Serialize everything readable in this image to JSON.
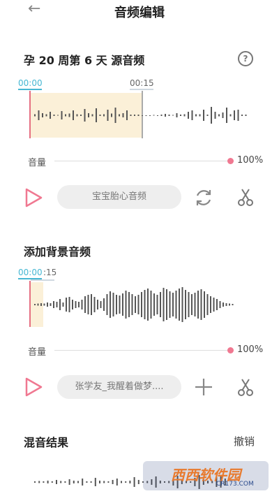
{
  "header": {
    "title": "音频编辑",
    "back_icon": "arrow-left-icon"
  },
  "source_section": {
    "title": "孕 20 周第 6 天 源音频",
    "help_icon": "question-circle-icon",
    "help_glyph": "?",
    "time_start": "00:00",
    "time_end": "00:15",
    "volume_label": "音量",
    "volume_value": "100%",
    "volume_level": 1.0,
    "play_icon": "play-icon",
    "clip_name": "宝宝胎心音频",
    "action_icon": "refresh-icon",
    "cut_icon": "scissors-icon"
  },
  "bg_section": {
    "title": "添加背景音频",
    "time_start": "00:00",
    "time_end": ":15",
    "volume_label": "音量",
    "volume_value": "100%",
    "volume_level": 1.0,
    "play_icon": "play-icon",
    "clip_name": "张学友_我醒着做梦....",
    "add_icon": "plus-icon",
    "cut_icon": "scissors-icon"
  },
  "mix_section": {
    "title": "混音结果",
    "undo_label": "撤销"
  },
  "watermark": {
    "text": "西西软件园",
    "sub": "CR173.COM"
  },
  "colors": {
    "accent_blue": "#46b7d3",
    "accent_pink": "#f07891",
    "highlight": "#fbf0d8"
  }
}
